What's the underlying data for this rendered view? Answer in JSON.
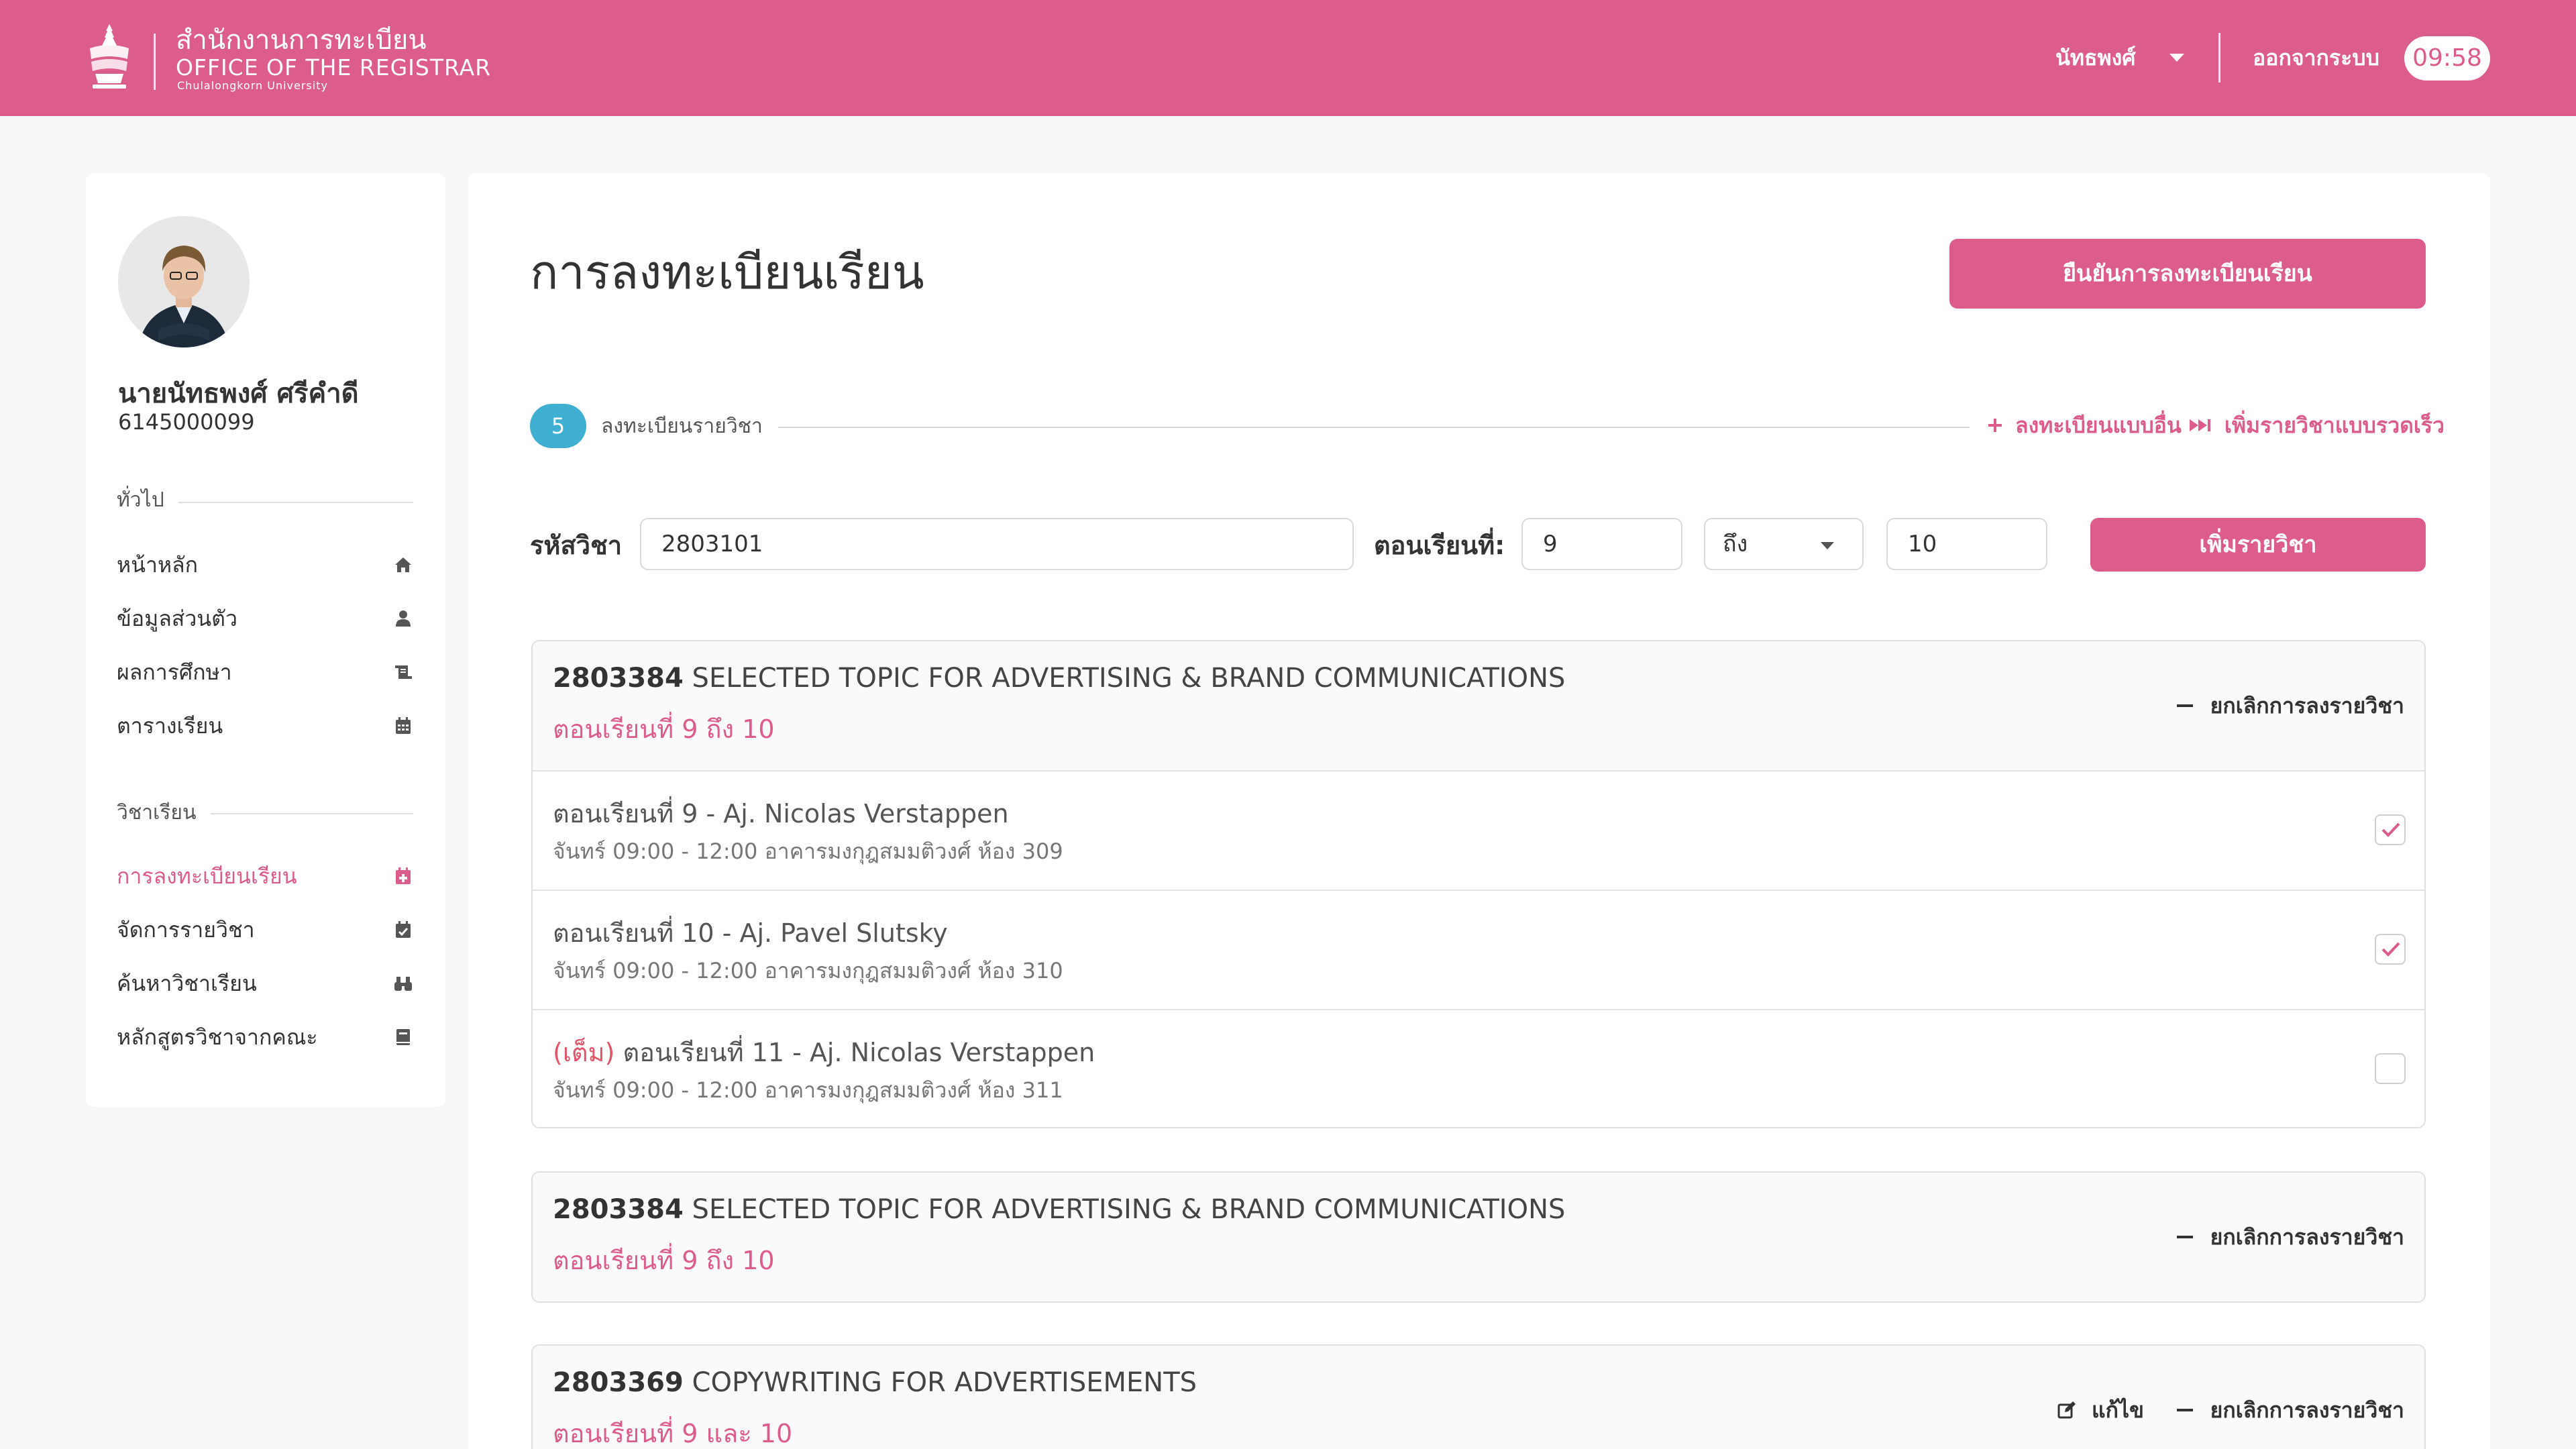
{
  "header": {
    "brand_th": "สำนักงานการทะเบียน",
    "brand_en": "OFFICE OF THE REGISTRAR",
    "brand_sub": "Chulalongkorn University",
    "user_menu": "นัทธพงศ์",
    "logout": "ออกจากระบบ",
    "timer": "09:58"
  },
  "profile": {
    "name": "นายนัทธพงศ์ ศรีคำดี",
    "student_id": "6145000099"
  },
  "sidebar": {
    "general_title": "ทั่วไป",
    "general_items": [
      {
        "label": "หน้าหลัก",
        "icon": "home-icon"
      },
      {
        "label": "ข้อมูลส่วนตัว",
        "icon": "user-icon"
      },
      {
        "label": "ผลการศึกษา",
        "icon": "scroll-icon"
      },
      {
        "label": "ตารางเรียน",
        "icon": "calendar-icon"
      }
    ],
    "courses_title": "วิชาเรียน",
    "course_items": [
      {
        "label": "การลงทะเบียนเรียน",
        "icon": "calendar-plus-icon",
        "active": true
      },
      {
        "label": "จัดการรายวิชา",
        "icon": "calendar-check-icon"
      },
      {
        "label": "ค้นหาวิชาเรียน",
        "icon": "binoculars-icon"
      },
      {
        "label": "หลักสูตรวิชาจากคณะ",
        "icon": "book-icon"
      }
    ]
  },
  "main": {
    "title": "การลงทะเบียนเรียน",
    "confirm_button": "ยืนยันการลงทะเบียนเรียน",
    "step_count": "5",
    "step_label": "ลงทะเบียนรายวิชา",
    "other_register_link": "ลงทะเบียนแบบอื่น",
    "quick_add_link": "เพิ่มรายวิชาแบบรวดเร็ว",
    "form": {
      "course_code_label": "รหัสวิชา",
      "course_code_value": "2803101",
      "section_label": "ตอนเรียนที่:",
      "section_from": "9",
      "range_select": "ถึง",
      "section_to": "10",
      "add_button": "เพิ่มรายวิชา"
    },
    "courses": [
      {
        "code": "2803384",
        "name": "SELECTED TOPIC FOR ADVERTISING & BRAND COMMUNICATIONS",
        "sections": "ตอนเรียนที่ 9 ถึง 10",
        "cancel": "ยกเลิกการลงรายวิชา",
        "section_rows": [
          {
            "full": "",
            "name": "ตอนเรียนที่ 9 - Aj. Nicolas Verstappen",
            "detail": "จันทร์ 09:00 - 12:00 อาคารมงกุฎสมมติวงศ์ ห้อง 309",
            "checked": true
          },
          {
            "full": "",
            "name": "ตอนเรียนที่ 10 - Aj. Pavel Slutsky",
            "detail": "จันทร์ 09:00 - 12:00 อาคารมงกุฎสมมติวงศ์ ห้อง 310",
            "checked": true
          },
          {
            "full": "(เต็ม)",
            "name": "ตอนเรียนที่ 11 - Aj. Nicolas Verstappen",
            "detail": "จันทร์ 09:00 - 12:00 อาคารมงกุฎสมมติวงศ์ ห้อง 311",
            "checked": false
          }
        ]
      },
      {
        "code": "2803384",
        "name": "SELECTED TOPIC FOR ADVERTISING & BRAND COMMUNICATIONS",
        "sections": "ตอนเรียนที่ 9 ถึง 10",
        "cancel": "ยกเลิกการลงรายวิชา"
      },
      {
        "code": "2803369",
        "name": "COPYWRITING FOR ADVERTISEMENTS",
        "sections": "ตอนเรียนที่ 9 และ 10",
        "edit": "แก้ไข",
        "cancel": "ยกเลิกการลงรายวิชา"
      }
    ]
  },
  "colors": {
    "brand_pink": "#dc5d8c",
    "step_blue": "#3fb0d2",
    "full_red": "#e2546a",
    "background": "#f7f7f7"
  }
}
